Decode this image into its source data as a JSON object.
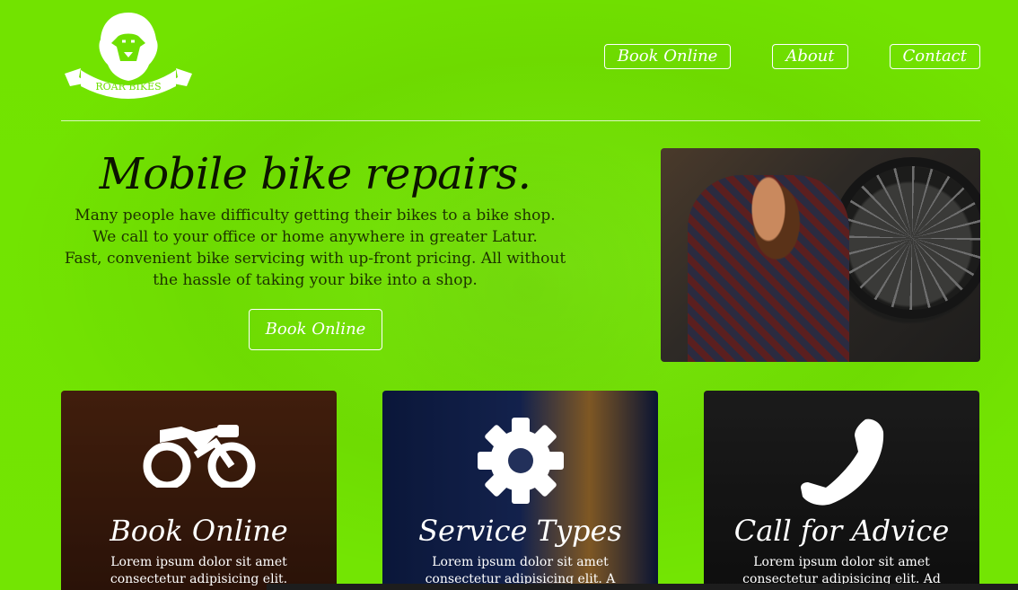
{
  "brand": {
    "logo_text": "ROAR BIKES"
  },
  "nav": {
    "items": [
      "Book Online",
      "About",
      "Contact"
    ]
  },
  "hero": {
    "title": "Mobile bike repairs.",
    "paragraph_1": "Many people have difficulty getting their bikes to a bike shop. We call to your office or home anywhere in greater Latur.",
    "paragraph_2": "Fast, convenient bike servicing with up-front pricing. All without the hassle of taking your bike into a shop.",
    "cta_label": "Book Online"
  },
  "cards": [
    {
      "title": "Book Online",
      "text": "Lorem ipsum dolor sit amet consectetur adipisicing elit.",
      "icon": "motorcycle-icon"
    },
    {
      "title": "Service Types",
      "text": "Lorem ipsum dolor sit amet consectetur adipisicing elit. A ipsa",
      "icon": "gear-icon"
    },
    {
      "title": "Call for Advice",
      "text": "Lorem ipsum dolor sit amet consectetur adipisicing elit. Ad natus",
      "icon": "phone-icon"
    }
  ],
  "colors": {
    "background": "#6ee000",
    "text_dark": "#0c1400",
    "accent_white": "#ffffff"
  }
}
